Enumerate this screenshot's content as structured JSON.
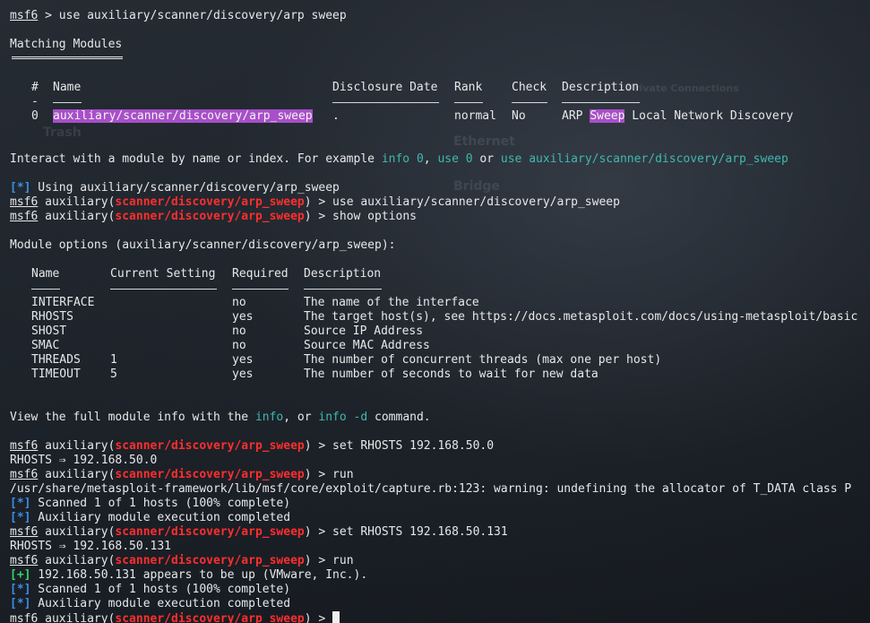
{
  "prompt": {
    "msf": "msf6",
    "aux": " auxiliary(",
    "module_path": "scanner/discovery/arp_sweep",
    "close": ") > "
  },
  "lines": {
    "l1_cmd": " > use auxiliary/scanner/discovery/arp sweep",
    "matching": "Matching Modules",
    "search_headers": {
      "idx": "#",
      "name": "Name",
      "date": "Disclosure Date",
      "rank": "Rank",
      "check": "Check",
      "desc": "Description",
      "idx_dash": "-"
    },
    "search_row": {
      "idx": "0",
      "name_a": "auxiliary/scanner/discovery/arp",
      "name_b": "_",
      "name_c": "sweep",
      "date": ".",
      "rank": "normal",
      "check": "No",
      "desc_a": "ARP ",
      "desc_b": "Sweep",
      "desc_c": " Local Network Discovery"
    },
    "interact": {
      "a": "Interact with a module by name or index. For example ",
      "b": "info 0",
      "c": ", ",
      "d": "use 0",
      "e": " or ",
      "f": "use auxiliary/scanner/discovery/arp_sweep"
    },
    "using_tag": "[*]",
    "using": " Using auxiliary/scanner/discovery/arp_sweep",
    "cmd_use": "use auxiliary/scanner/discovery/arp_sweep",
    "cmd_show": "show options",
    "module_options": "Module options (auxiliary/scanner/discovery/arp_sweep):",
    "opt_headers": {
      "name": "Name",
      "setting": "Current Setting",
      "required": "Required",
      "desc": "Description"
    },
    "options": [
      {
        "name": "INTERFACE",
        "setting": "",
        "required": "no",
        "desc": "The name of the interface"
      },
      {
        "name": "RHOSTS",
        "setting": "",
        "required": "yes",
        "desc": "The target host(s), see https://docs.metasploit.com/docs/using-metasploit/basic"
      },
      {
        "name": "SHOST",
        "setting": "",
        "required": "no",
        "desc": "Source IP Address"
      },
      {
        "name": "SMAC",
        "setting": "",
        "required": "no",
        "desc": "Source MAC Address"
      },
      {
        "name": "THREADS",
        "setting": "1",
        "required": "yes",
        "desc": "The number of concurrent threads (max one per host)"
      },
      {
        "name": "TIMEOUT",
        "setting": "5",
        "required": "yes",
        "desc": "The number of seconds to wait for new data"
      }
    ],
    "view": {
      "a": "View the full module info with the ",
      "b": "info",
      "c": ", or ",
      "d": "info -d",
      "e": " command."
    },
    "cmd_set1": "set RHOSTS 192.168.50.0",
    "rhosts1": "RHOSTS ⇒ 192.168.50.0",
    "cmd_run": "run",
    "warning": "/usr/share/metasploit-framework/lib/msf/core/exploit/capture.rb:123: warning: undefining the allocator of T_DATA class P",
    "scanned": " Scanned 1 of 1 hosts (100% complete)",
    "completed": " Auxiliary module execution completed",
    "cmd_set2": "set RHOSTS 192.168.50.131",
    "rhosts2": "RHOSTS ⇒ 192.168.50.131",
    "good_tag": "[+]",
    "host_up": " 192.168.50.131 appears to be up (VMware, Inc.)."
  },
  "background": {
    "w1": "Ethernet",
    "w2": "Bridge",
    "w3": "Trash",
    "w4": "Private Connections"
  }
}
